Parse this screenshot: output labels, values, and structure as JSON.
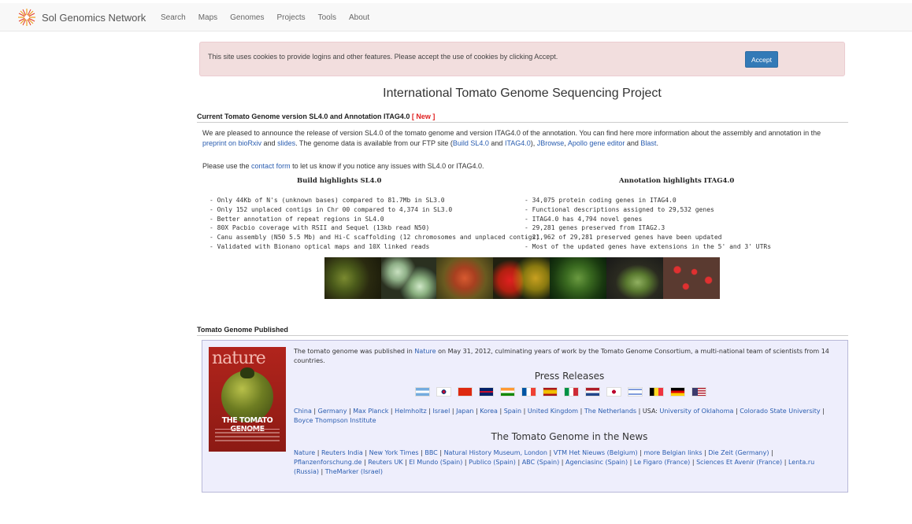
{
  "nav": {
    "brand": "Sol Genomics Network",
    "links": [
      "Search",
      "Maps",
      "Genomes",
      "Projects",
      "Tools",
      "About"
    ]
  },
  "cookie": {
    "message": "This site uses cookies to provide logins and other features. Please accept the use of cookies by clicking Accept.",
    "accept_label": "Accept"
  },
  "page_title": "International Tomato Genome Sequencing Project",
  "current": {
    "heading": "Current Tomato Genome version SL4.0 and Annotation ITAG4.0",
    "new_badge": "[ New ]",
    "p1_a": "We are pleased to announce the release of version SL4.0 of the tomato genome and version ITAG4.0 of the annotation. You can find here more information about the assembly and annotation in the ",
    "link_preprint": "preprint on bioRxiv",
    "p1_b": " and ",
    "link_slides": "slides",
    "p1_c": ". The genome data is available from our FTP site (",
    "link_build": "Build SL4.0",
    "p1_d": " and ",
    "link_itag": "ITAG4.0",
    "p1_e": "), ",
    "link_jbrowse": "JBrowse",
    "p1_f": ", ",
    "link_apollo": "Apollo gene editor",
    "p1_g": " and ",
    "link_blast": "Blast",
    "p1_h": ".",
    "p2_a": "Please use the ",
    "link_contact": "contact form",
    "p2_b": " to let us know if you notice any issues with SL4.0 or ITAG4.0."
  },
  "build": {
    "title": "Build highlights SL4.0",
    "items": [
      "- Only 44Kb of N's (unknown bases) compared to 81.7Mb in SL3.0",
      "- Only 152 unplaced contigs in Chr 00 compared to 4,374 in SL3.0",
      "- Better annotation of repeat regions in SL4.0",
      "- 80X Pacbio coverage with RSII and Sequel (13kb read N50)",
      "- Canu assembly (N50 5.5 Mb) and Hi-C scaffolding (12 chromosomes and unplaced contigs)",
      "- Validated with Bionano optical maps and 10X linked reads"
    ]
  },
  "annotation": {
    "title": "Annotation highlights ITAG4.0",
    "items": [
      "- 34,075 protein coding genes in ITAG4.0",
      "- Functional descriptions assigned to 29,532 genes",
      "- ITAG4.0 has 4,794 novel genes",
      "- 29,281 genes preserved from ITAG2.3",
      "- 21,962 of 29,281 preserved genes have been updated",
      "- Most of the updated genes have extensions in the 5' and 3' UTRs"
    ]
  },
  "published": {
    "heading": "Tomato Genome Published",
    "cover_masthead": "nature",
    "cover_title": "THE TOMATO GENOME",
    "text_a": "The tomato genome was published in ",
    "link_nature": "Nature",
    "text_b": " on May 31, 2012, culminating years of work by the Tomato Genome Consortium, a multi-national team of scientists from 14 countries.",
    "press_heading": "Press Releases",
    "press_links": [
      "China",
      "Germany",
      "Max Planck",
      "Helmholtz",
      "Israel",
      "Japan",
      "Korea",
      "Spain",
      "United Kingdom",
      "The Netherlands"
    ],
    "press_usa_label": "USA: ",
    "press_usa_links": [
      "University of Oklahoma",
      "Colorado State University",
      "Boyce Thompson Institute"
    ],
    "news_heading": "The Tomato Genome in the News",
    "news_links": [
      "Nature",
      "Reuters India",
      "New York Times",
      "BBC",
      "Natural History Museum, London",
      "VTM Het Nieuws (Belgium)",
      "more Belgian links",
      "Die Zeit (Germany)",
      "Pflanzenforschung.de",
      "Reuters UK",
      "El Mundo (Spain)",
      "Publico (Spain)",
      "ABC (Spain)",
      "Agenciasinc (Spain)",
      "Le Figaro (France)",
      "Sciences Et Avenir (France)",
      "Lenta.ru (Russia)",
      "TheMarker (Israel)"
    ],
    "flags": [
      "argentina-flag",
      "korea-flag",
      "china-flag",
      "uk-flag",
      "india-flag",
      "france-flag",
      "spain-flag",
      "italy-flag",
      "netherlands-flag",
      "japan-flag",
      "israel-flag",
      "belgium-flag",
      "germany-flag",
      "usa-flag"
    ]
  }
}
